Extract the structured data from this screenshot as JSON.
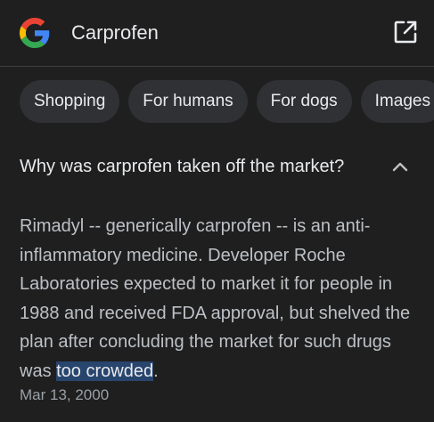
{
  "header": {
    "query": "Carprofen",
    "logo_icon": "google-g-icon",
    "open_icon": "open-in-new-icon"
  },
  "chips": [
    {
      "label": "Shopping"
    },
    {
      "label": "For humans"
    },
    {
      "label": "For dogs"
    },
    {
      "label": "Images"
    }
  ],
  "faq": {
    "question": "Why was carprofen taken off the market?",
    "chevron_icon": "chevron-up-icon",
    "answer_before": "Rimadyl -- generically carprofen -- is an anti-inflammatory medicine. Developer Roche Laboratories expected to market it for people in 1988 and received FDA approval, but shelved the plan after concluding the market for such drugs was ",
    "answer_highlight": "too crowded",
    "answer_after": ".",
    "date": "Mar 13, 2000"
  },
  "colors": {
    "background": "#1f1f1f",
    "chip_background": "#303134",
    "highlight": "#28456e",
    "google_blue": "#4285F4",
    "google_red": "#EA4335",
    "google_yellow": "#FBBC05",
    "google_green": "#34A853"
  }
}
